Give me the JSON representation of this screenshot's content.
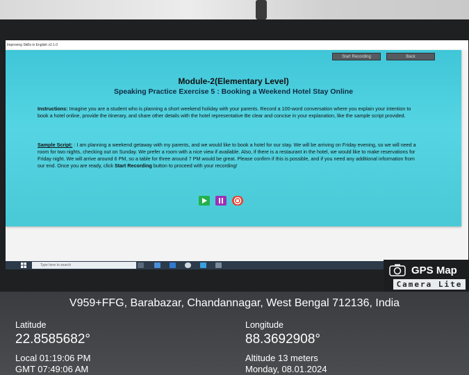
{
  "window": {
    "title": "Improving Skills in English v2.1.0"
  },
  "toolbar": {
    "start_recording_label": "Start Recording",
    "back_label": "Back"
  },
  "content": {
    "module_title": "Module-2(Elementary Level)",
    "exercise_title": "Speaking Practice Exercise 5 : Booking a Weekend Hotel Stay Online",
    "instructions_label": "Instructions:",
    "instructions_text": " Imagine you are a student who is planning a short weekend holiday with your parents. Record a 100-word conversation where you explain your intention to book a hotel online, provide the itinerary, and share other details with the hotel representative Be clear and concise in your explanation, like the sample script provided.",
    "sample_label": "Sample Script:",
    "sample_text": " : I am planning a weekend getaway with my parents, and we would like to book a hotel for our stay. We will be arriving on Friday evening, so we will need a room for two nights, checking out on Sunday. We prefer a room with a nice view if available. Also, if there is a restaurant in the hotel, we would like to make reservations for Friday night. We will arrive around 6 PM, so a table for three around 7 PM would be great. Please confirm if this is possible, and if you need any additional information from our end. Once you are ready, click ",
    "sample_bold": "Start Recording",
    "sample_tail": " button to proceed with your recording!"
  },
  "controls": {
    "play_icon": "play-icon",
    "pause_icon": "pause-icon",
    "stop_icon": "stop-icon"
  },
  "taskbar": {
    "search_placeholder": "Type here to search"
  },
  "gps_badge": {
    "title": "GPS Map",
    "subtitle": "Camera Lite"
  },
  "location": {
    "address": "V959+FFG, Barabazar, Chandannagar, West Bengal 712136, India",
    "latitude_label": "Latitude",
    "latitude": "22.8585682°",
    "longitude_label": "Longitude",
    "longitude": "88.3692908°",
    "local_time": "Local 01:19:06 PM",
    "gmt_time": "GMT 07:49:06 AM",
    "altitude": "Altitude 13 meters",
    "date": "Monday, 08.01.2024"
  },
  "colors": {
    "panel": "#4fcfdf",
    "play": "#24b14c",
    "pause": "#9b31b7",
    "stop": "#e8402f"
  }
}
